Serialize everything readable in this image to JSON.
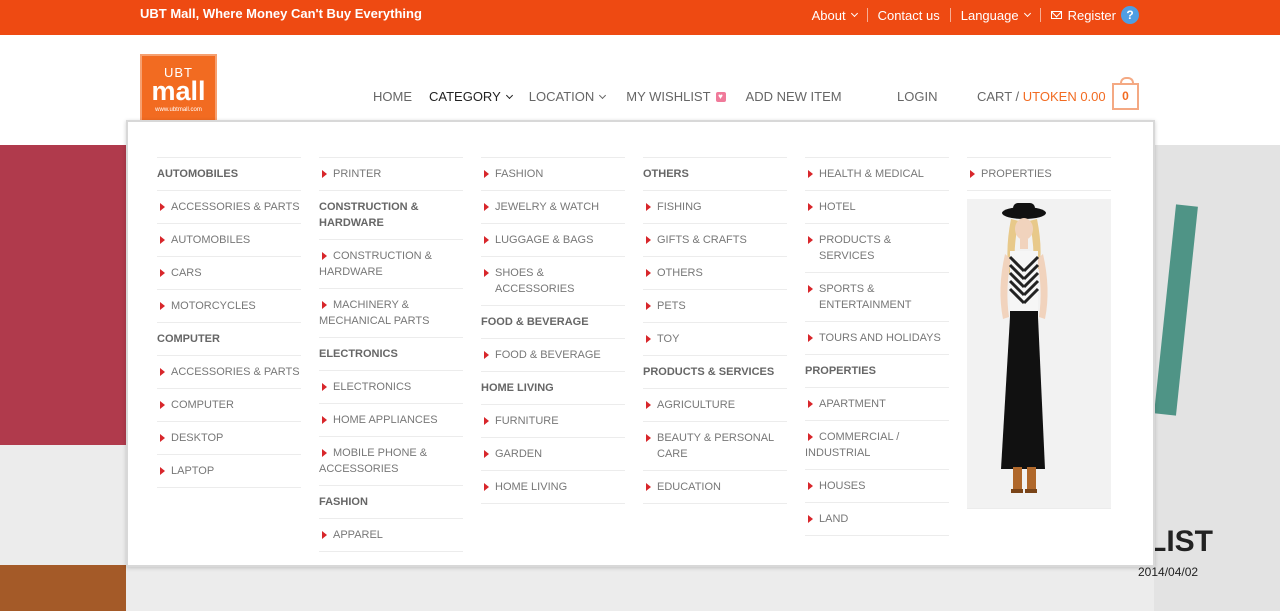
{
  "topbar": {
    "tagline": "UBT Mall, Where Money Can't Buy Everything",
    "links": {
      "about": "About",
      "contact": "Contact us",
      "language": "Language",
      "register": "Register",
      "help": "?"
    }
  },
  "logo": {
    "line1": "UBT",
    "line2": "mall",
    "url": "www.ubtmall.com"
  },
  "nav": {
    "home": "HOME",
    "category": "CATEGORY",
    "location": "LOCATION",
    "wishlist": "MY WISHLIST",
    "add_item": "ADD NEW ITEM",
    "login": "LOGIN",
    "cart_label": "CART / ",
    "cart_token": "UTOKEN 0.00",
    "cart_count": "0"
  },
  "banner": {
    "text": "LIST",
    "date": "2014/04/02"
  },
  "menu": {
    "col1": [
      {
        "type": "head",
        "label": "AUTOMOBILES"
      },
      {
        "type": "link",
        "label": "ACCESSORIES & PARTS"
      },
      {
        "type": "link",
        "label": "AUTOMOBILES"
      },
      {
        "type": "link",
        "label": "CARS"
      },
      {
        "type": "link",
        "label": "MOTORCYCLES"
      },
      {
        "type": "head",
        "label": "COMPUTER"
      },
      {
        "type": "link",
        "label": "ACCESSORIES & PARTS"
      },
      {
        "type": "link",
        "label": "COMPUTER"
      },
      {
        "type": "link",
        "label": "DESKTOP"
      },
      {
        "type": "link",
        "label": "LAPTOP"
      }
    ],
    "col2": [
      {
        "type": "link",
        "label": "PRINTER"
      },
      {
        "type": "head",
        "label": "CONSTRUCTION & HARDWARE"
      },
      {
        "type": "link",
        "label": "CONSTRUCTION & HARDWARE"
      },
      {
        "type": "link",
        "label": "MACHINERY & MECHANICAL PARTS"
      },
      {
        "type": "head",
        "label": "ELECTRONICS"
      },
      {
        "type": "link",
        "label": "ELECTRONICS"
      },
      {
        "type": "link",
        "label": "HOME APPLIANCES"
      },
      {
        "type": "link",
        "label": "MOBILE PHONE & ACCESSORIES"
      },
      {
        "type": "head",
        "label": "FASHION"
      },
      {
        "type": "link",
        "label": "APPAREL"
      }
    ],
    "col3": [
      {
        "type": "link",
        "label": "FASHION"
      },
      {
        "type": "link",
        "label": "JEWELRY & WATCH"
      },
      {
        "type": "link",
        "label": "LUGGAGE & BAGS"
      },
      {
        "type": "link",
        "label": "SHOES & ACCESSORIES"
      },
      {
        "type": "head",
        "label": "FOOD & BEVERAGE"
      },
      {
        "type": "link",
        "label": "FOOD & BEVERAGE"
      },
      {
        "type": "head",
        "label": "HOME LIVING"
      },
      {
        "type": "link",
        "label": "FURNITURE"
      },
      {
        "type": "link",
        "label": "GARDEN"
      },
      {
        "type": "link",
        "label": "HOME LIVING"
      }
    ],
    "col4": [
      {
        "type": "head",
        "label": "OTHERS"
      },
      {
        "type": "link",
        "label": "FISHING"
      },
      {
        "type": "link",
        "label": "GIFTS & CRAFTS"
      },
      {
        "type": "link",
        "label": "OTHERS"
      },
      {
        "type": "link",
        "label": "PETS"
      },
      {
        "type": "link",
        "label": "TOY"
      },
      {
        "type": "head",
        "label": "PRODUCTS & SERVICES"
      },
      {
        "type": "link",
        "label": "AGRICULTURE"
      },
      {
        "type": "link",
        "label": "BEAUTY & PERSONAL CARE"
      },
      {
        "type": "link",
        "label": "EDUCATION"
      }
    ],
    "col5": [
      {
        "type": "link",
        "label": "HEALTH & MEDICAL"
      },
      {
        "type": "link",
        "label": "HOTEL"
      },
      {
        "type": "link",
        "label": "PRODUCTS & SERVICES"
      },
      {
        "type": "link",
        "label": "SPORTS & ENTERTAINMENT"
      },
      {
        "type": "link",
        "label": "TOURS AND HOLIDAYS"
      },
      {
        "type": "head",
        "label": "PROPERTIES"
      },
      {
        "type": "link",
        "label": "APARTMENT"
      },
      {
        "type": "link",
        "label": "COMMERCIAL / INDUSTRIAL"
      },
      {
        "type": "link",
        "label": "HOUSES"
      },
      {
        "type": "link",
        "label": "LAND"
      }
    ],
    "col6": [
      {
        "type": "link",
        "label": "PROPERTIES"
      }
    ]
  },
  "colors": {
    "topbar": "#ee4a12",
    "accent": "#f26b21",
    "arrow": "#d8262b"
  }
}
